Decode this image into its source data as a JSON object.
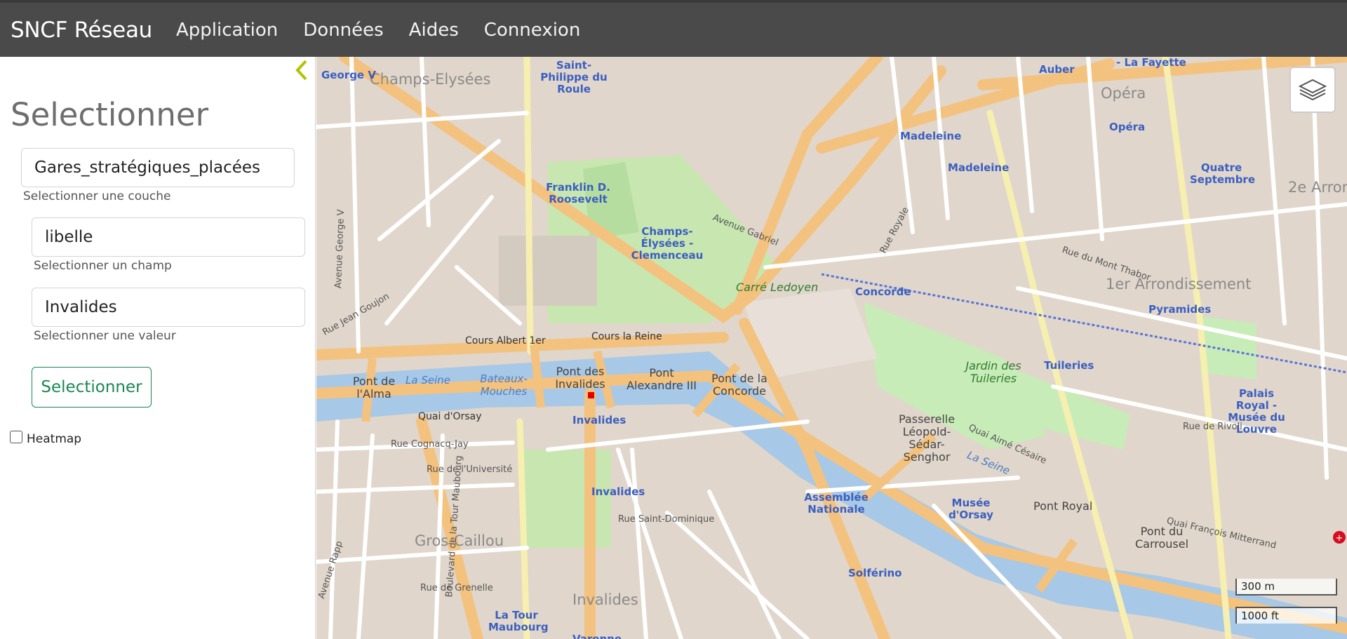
{
  "navbar": {
    "brand": "SNCF Réseau",
    "items": [
      "Application",
      "Données",
      "Aides",
      "Connexion"
    ]
  },
  "sidebar": {
    "title": "Selectionner",
    "layer": {
      "value": "Gares_stratégiques_placées",
      "help": "Selectionner une couche"
    },
    "field": {
      "value": "libelle",
      "help": "Selectionner un champ"
    },
    "value": {
      "value": "Invalides",
      "help": "Selectionner une valeur"
    },
    "select_button": "Selectionner",
    "heatmap_label": "Heatmap",
    "heatmap_checked": false
  },
  "map": {
    "scale_metric": "300 m",
    "scale_imperial": "1000 ft",
    "areas": [
      "Champs-Elysées",
      "Opéra",
      "1er Arrondissement",
      "Gros-Caillou",
      "Invalides",
      "2e Arron"
    ],
    "metro_stations": [
      "George V",
      "Saint-Philippe du Roule",
      "Franklin D. Roosevelt",
      "Champs-Élysées - Clemenceau",
      "Madeleine",
      "Madeleine",
      "Opéra",
      "Quatre Septembre",
      "Concorde",
      "Pyramides",
      "Tuileries",
      "Invalides",
      "Invalides",
      "Assemblée Nationale",
      "Musée d'Orsay",
      "Solférino",
      "La Tour Maubourg",
      "Auber",
      "Palais Royal - Musée du Louvre",
      "- La Fayette",
      "Varenne"
    ],
    "places": [
      "Pont de l'Alma",
      "Pont des Invalides",
      "Pont Alexandre III",
      "Pont de la Concorde",
      "Passerelle Léopold-Sédar-Senghor",
      "Pont Royal",
      "Pont du Carrousel",
      "Bateaux-Mouches"
    ],
    "parks": [
      "Carré Ledoyen",
      "Jardin des Tuileries"
    ],
    "rivers": [
      "La Seine",
      "La Seine"
    ],
    "streets": [
      "Cours Albert 1er",
      "Cours la Reine",
      "Quai d'Orsay",
      "Quai Aimé Césaire",
      "Quai François Mitterrand",
      "Rue Royale",
      "Avenue Gabriel",
      "Rue Saint-Dominique",
      "Boulevard de la Tour Maubourg",
      "Avenue Rapp",
      "Rue de l'Université",
      "Rue de Grenelle",
      "Rue Cognacq-Jay",
      "Avenue George V",
      "Rue Jean Goujon",
      "Rue du Mont Thabor",
      "Rue de Rivoli"
    ]
  }
}
